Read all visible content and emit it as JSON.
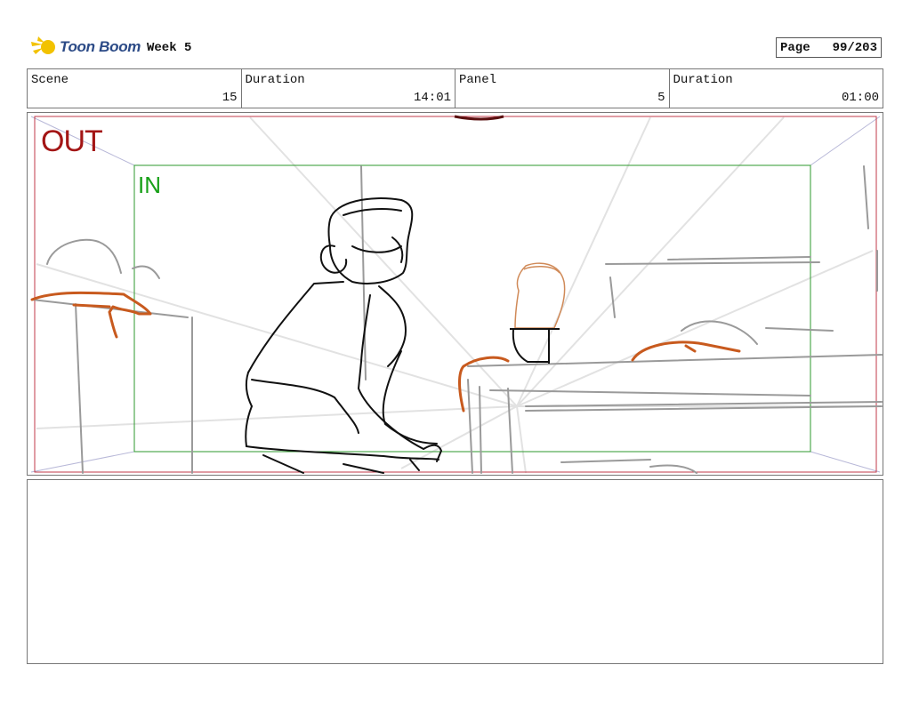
{
  "header": {
    "brand": "Toon Boom",
    "title": "Week 5",
    "page_label": "Page",
    "page_value": "99/203"
  },
  "info": {
    "scene_label": "Scene",
    "scene_value": "15",
    "duration_label": "Duration",
    "duration_value": "14:01",
    "panel_label": "Panel",
    "panel_value": "5",
    "panel_duration_label": "Duration",
    "panel_duration_value": "01:00"
  },
  "frame": {
    "out_label": "OUT",
    "in_label": "IN",
    "out_color": "#a31515",
    "in_color": "#18a018"
  },
  "notes": {
    "text": ""
  }
}
